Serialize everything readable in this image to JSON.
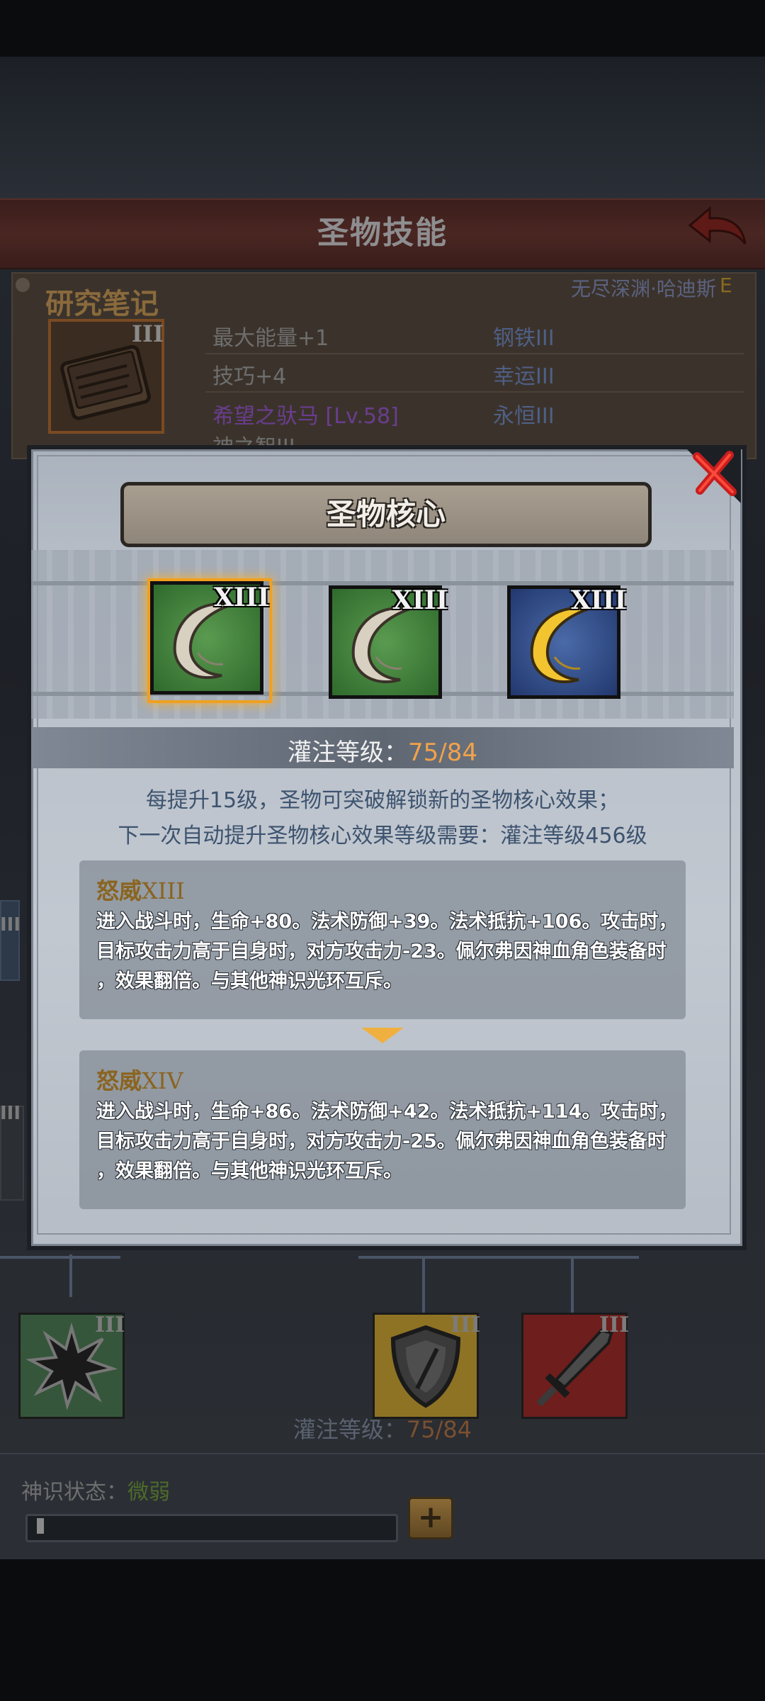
{
  "header": {
    "title": "圣物技能"
  },
  "research_notes": {
    "title": "研究笔记",
    "location": "无尽深渊·哈迪斯",
    "grade": "E",
    "book_tier": "III",
    "stats": [
      {
        "left": "最大能量+1",
        "right": "钢铁III"
      },
      {
        "left": "技巧+4",
        "right": "幸运III"
      },
      {
        "left": "希望之驮马 [Lv.58]",
        "right": "永恒III"
      }
    ],
    "partial_line": "神之智III",
    "colors": {
      "stat_text": "#6e6e6e",
      "right_text": "#4f5f86",
      "special_text": "#6a3d8f"
    }
  },
  "modal": {
    "title": "圣物核心",
    "cores": [
      {
        "tier": "XIII",
        "color": "green",
        "selected": true
      },
      {
        "tier": "XIII",
        "color": "green",
        "selected": false
      },
      {
        "tier": "XIII",
        "color": "blue-gold",
        "selected": false
      }
    ],
    "infuse_label": "灌注等级：",
    "infuse_value": "75/84",
    "hint_line1": "每提升15级，圣物可突破解锁新的圣物核心效果；",
    "hint_line2": "下一次自动提升圣物核心效果等级需要：灌注等级456级",
    "current_effect": {
      "name": "怒威",
      "tier": "XIII",
      "line1": "进入战斗时，生命+80。法术防御+39。法术抵抗+106。攻击时，",
      "line2": "目标攻击力高于自身时，对方攻击力-23。佩尔弗因神血角色装备时",
      "line3": "，效果翻倍。与其他神识光环互斥。"
    },
    "next_effect": {
      "name": "怒威",
      "tier": "XIV",
      "line1": "进入战斗时，生命+86。法术防御+42。法术抵抗+114。攻击时，",
      "line2": "目标攻击力高于自身时，对方攻击力-25。佩尔弗因神血角色装备时",
      "line3": "，效果翻倍。与其他神识光环互斥。"
    }
  },
  "background": {
    "left_edge_tier_1": "III",
    "left_edge_tier_2": "III",
    "skills": [
      {
        "icon": "burst-icon",
        "tier": "III",
        "color": "#3f6a3a"
      },
      {
        "icon": "shield-icon",
        "tier": "III",
        "color": "#a8862a"
      },
      {
        "icon": "sword-icon",
        "tier": "III",
        "color": "#8a2420"
      }
    ],
    "infuse_label": "灌注等级：",
    "infuse_value": "75/84",
    "divine_label": "神识状态：",
    "divine_value": "微弱",
    "divine_progress": 0.02,
    "plus_label": "+"
  }
}
